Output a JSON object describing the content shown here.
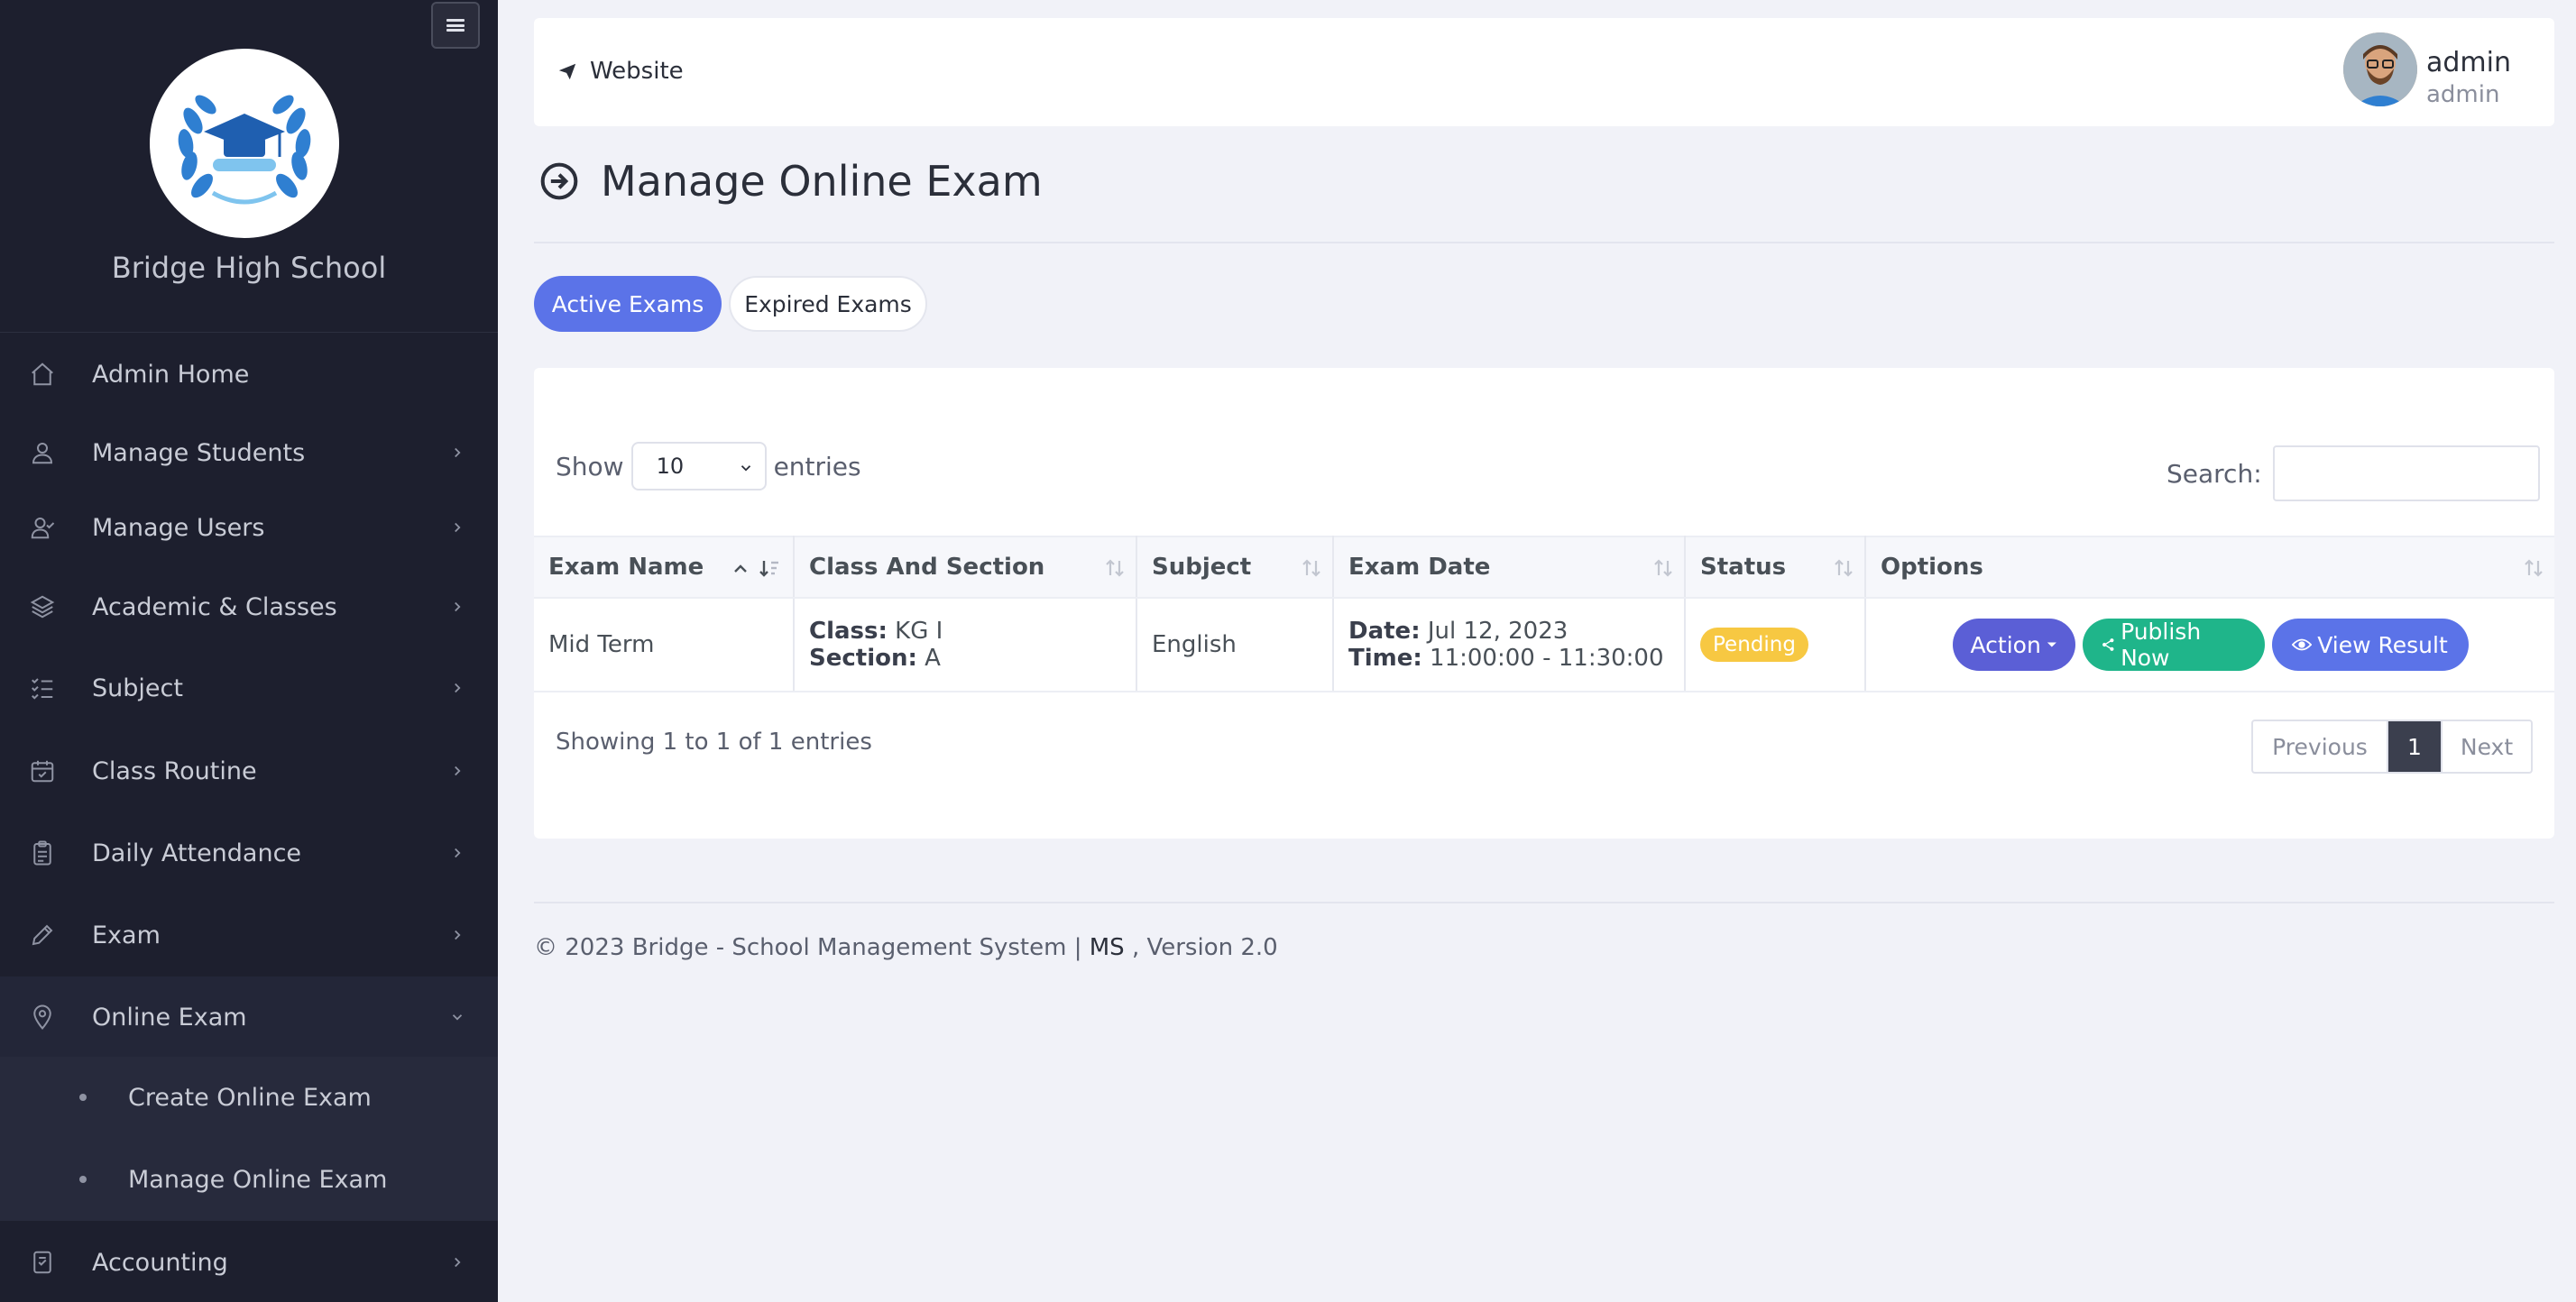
{
  "sidebar": {
    "school_name": "Bridge High School",
    "items": [
      {
        "label": "Admin Home",
        "icon": "home-icon"
      },
      {
        "label": "Manage Students",
        "icon": "user-icon"
      },
      {
        "label": "Manage Users",
        "icon": "users-icon"
      },
      {
        "label": "Academic & Classes",
        "icon": "layers-icon"
      },
      {
        "label": "Subject",
        "icon": "checklist-icon"
      },
      {
        "label": "Class Routine",
        "icon": "calendar-icon"
      },
      {
        "label": "Daily Attendance",
        "icon": "clipboard-icon"
      },
      {
        "label": "Exam",
        "icon": "pencil-icon"
      },
      {
        "label": "Online Exam",
        "icon": "map-pin-icon"
      },
      {
        "label": "Accounting",
        "icon": "receipt-icon"
      }
    ],
    "sub_items": [
      {
        "label": "Create Online Exam"
      },
      {
        "label": "Manage Online Exam"
      }
    ]
  },
  "topbar": {
    "website_label": "Website",
    "user_name": "admin",
    "user_role": "admin"
  },
  "page": {
    "title": "Manage Online Exam"
  },
  "tabs": {
    "active": "Active Exams",
    "expired": "Expired Exams"
  },
  "table_controls": {
    "show_label": "Show",
    "entries_label": "entries",
    "page_size": "10",
    "search_label": "Search:"
  },
  "table": {
    "headers": [
      "Exam Name",
      "Class And Section",
      "Subject",
      "Exam Date",
      "Status",
      "Options"
    ],
    "rows": [
      {
        "exam_name": "Mid Term",
        "class_label": "Class:",
        "class_value": "KG I",
        "section_label": "Section:",
        "section_value": "A",
        "subject": "English",
        "date_label": "Date:",
        "date_value": "Jul 12, 2023",
        "time_label": "Time:",
        "time_value": "11:00:00 - 11:30:00",
        "status": "Pending",
        "action_label": "Action",
        "publish_label": "Publish Now",
        "view_label": "View Result"
      }
    ]
  },
  "pagination": {
    "showing": "Showing 1 to 1 of 1 entries",
    "previous": "Previous",
    "current": "1",
    "next": "Next"
  },
  "footer": {
    "text": "© 2023 Bridge - School Management System |",
    "ms": "MS",
    "version": ", Version 2.0"
  },
  "colors": {
    "sidebar_bg": "#1d1f2e",
    "primary": "#5b73e8",
    "success": "#1fb58a",
    "warning": "#f7c842",
    "action": "#5b5fd6"
  }
}
